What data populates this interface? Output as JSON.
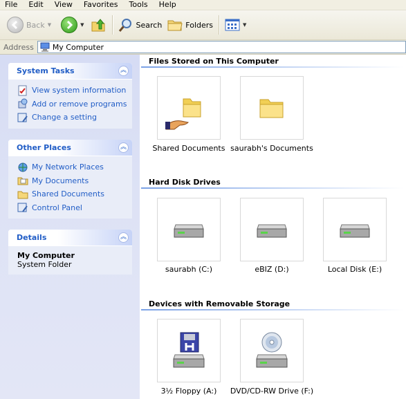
{
  "menu": [
    "File",
    "Edit",
    "View",
    "Favorites",
    "Tools",
    "Help"
  ],
  "toolbar": {
    "back_label": "Back",
    "search_label": "Search",
    "folders_label": "Folders"
  },
  "address": {
    "label": "Address",
    "value": "My Computer"
  },
  "sidebar": {
    "system_tasks": {
      "title": "System Tasks",
      "items": [
        "View system information",
        "Add or remove programs",
        "Change a setting"
      ]
    },
    "other_places": {
      "title": "Other Places",
      "items": [
        "My Network Places",
        "My Documents",
        "Shared Documents",
        "Control Panel"
      ]
    },
    "details": {
      "title": "Details",
      "name": "My Computer",
      "type": "System Folder"
    }
  },
  "main": {
    "groups": [
      {
        "title": "Files Stored on This Computer",
        "items": [
          {
            "label": "Shared Documents",
            "icon": "shared-folder-icon"
          },
          {
            "label": "saurabh's Documents",
            "icon": "folder-icon"
          }
        ]
      },
      {
        "title": "Hard Disk Drives",
        "items": [
          {
            "label": "saurabh (C:)",
            "icon": "hard-disk-icon"
          },
          {
            "label": "eBIZ (D:)",
            "icon": "hard-disk-icon"
          },
          {
            "label": "Local Disk (E:)",
            "icon": "hard-disk-icon"
          }
        ]
      },
      {
        "title": "Devices with Removable Storage",
        "items": [
          {
            "label": "3½ Floppy (A:)",
            "icon": "floppy-drive-icon"
          },
          {
            "label": "DVD/CD-RW Drive (F:)",
            "icon": "dvd-drive-icon"
          }
        ]
      }
    ]
  },
  "colors": {
    "link_blue": "#215dc6",
    "sidebar_bg": "#d6dcf4",
    "menubar_bg": "#f1efe2"
  }
}
